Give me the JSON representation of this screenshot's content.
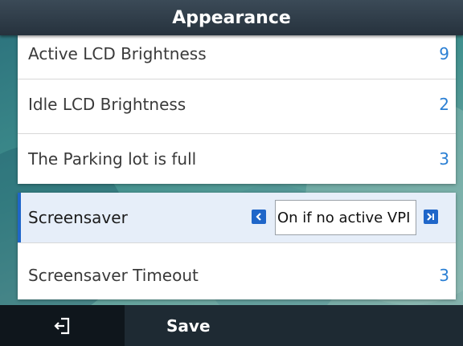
{
  "header": {
    "title": "Appearance"
  },
  "items": [
    {
      "label": "Active LCD Brightness",
      "value": "9"
    },
    {
      "label": "Idle LCD Brightness",
      "value": "2"
    },
    {
      "label": "The Parking lot is full",
      "value": "3"
    }
  ],
  "selected_item": {
    "label": "Screensaver",
    "value": "On if no active VPI"
  },
  "items_after": [
    {
      "label": "Screensaver Timeout",
      "value": "3"
    }
  ],
  "footer": {
    "save_label": "Save"
  },
  "colors": {
    "accent": "#1f66c9",
    "value_text": "#2a7fd4",
    "header_bg": "#2f3b46",
    "footer_bg": "#1e2a33"
  }
}
